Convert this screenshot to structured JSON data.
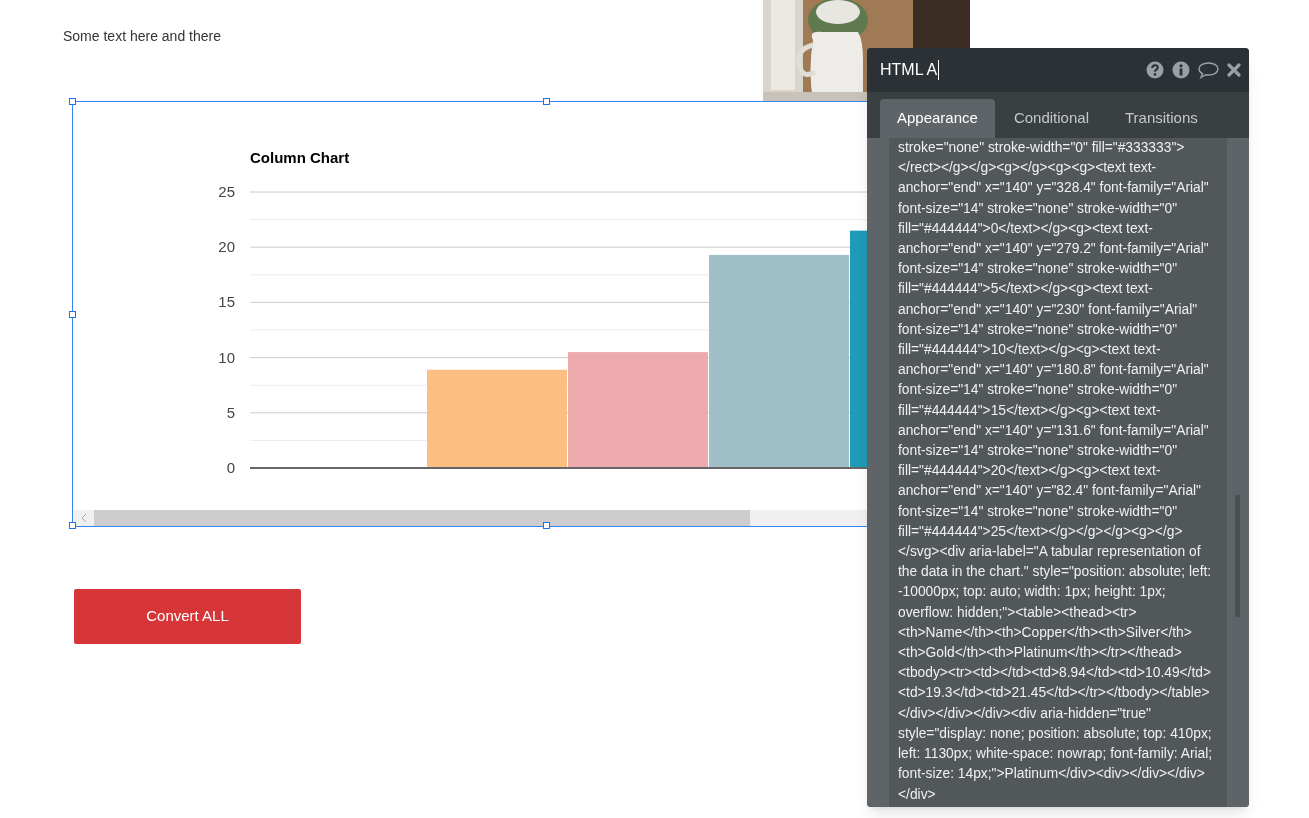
{
  "page": {
    "text": "Some text here and there"
  },
  "chart": {
    "chart_data": {
      "type": "bar",
      "title": "Column Chart",
      "ylim": [
        0,
        25
      ],
      "yticks": [
        0,
        5,
        10,
        15,
        20,
        25
      ],
      "grid": true,
      "series": [
        {
          "color": "#fdbe82",
          "values": [
            8.9
          ]
        },
        {
          "color": "#eeabad",
          "values": [
            10.5
          ]
        },
        {
          "color": "#a0bfc6",
          "values": [
            19.3
          ]
        },
        {
          "color": "#1e9bb8",
          "values": [
            21.5
          ]
        }
      ]
    }
  },
  "button": "Convert ALL",
  "panel": {
    "title": "HTML A",
    "tabs": [
      {
        "label": "Appearance",
        "selected": true
      },
      {
        "label": "Conditional",
        "selected": false
      },
      {
        "label": "Transitions",
        "selected": false
      }
    ],
    "code": "stroke=\"none\" stroke-width=\"0\" fill=\"#333333\"></rect></g></g><g></g><g><g><text text-anchor=\"end\" x=\"140\" y=\"328.4\" font-family=\"Arial\" font-size=\"14\" stroke=\"none\" stroke-width=\"0\" fill=\"#444444\">0</text></g><g><text text-anchor=\"end\" x=\"140\" y=\"279.2\" font-family=\"Arial\" font-size=\"14\" stroke=\"none\" stroke-width=\"0\" fill=\"#444444\">5</text></g><g><text text-anchor=\"end\" x=\"140\" y=\"230\" font-family=\"Arial\" font-size=\"14\" stroke=\"none\" stroke-width=\"0\" fill=\"#444444\">10</text></g><g><text text-anchor=\"end\" x=\"140\" y=\"180.8\" font-family=\"Arial\" font-size=\"14\" stroke=\"none\" stroke-width=\"0\" fill=\"#444444\">15</text></g><g><text text-anchor=\"end\" x=\"140\" y=\"131.6\" font-family=\"Arial\" font-size=\"14\" stroke=\"none\" stroke-width=\"0\" fill=\"#444444\">20</text></g><g><text text-anchor=\"end\" x=\"140\" y=\"82.4\" font-family=\"Arial\" font-size=\"14\" stroke=\"none\" stroke-width=\"0\" fill=\"#444444\">25</text></g></g></g><g></g></svg><div aria-label=\"A tabular representation of the data in the chart.\" style=\"position: absolute; left: -10000px; top: auto; width: 1px; height: 1px; overflow: hidden;\"><table><thead><tr><th>Name</th><th>Copper</th><th>Silver</th><th>Gold</th><th>Platinum</th></tr></thead><tbody><tr><td></td><td>8.94</td><td>10.49</td><td>19.3</td><td>21.45</td></tr></tbody></table></div></div></div><div aria-hidden=\"true\" style=\"display: none; position: absolute; top: 410px; left: 1130px; white-space: nowrap; font-family: Arial; font-size: 14px;\">Platinum</div><div></div></div></div>"
  }
}
